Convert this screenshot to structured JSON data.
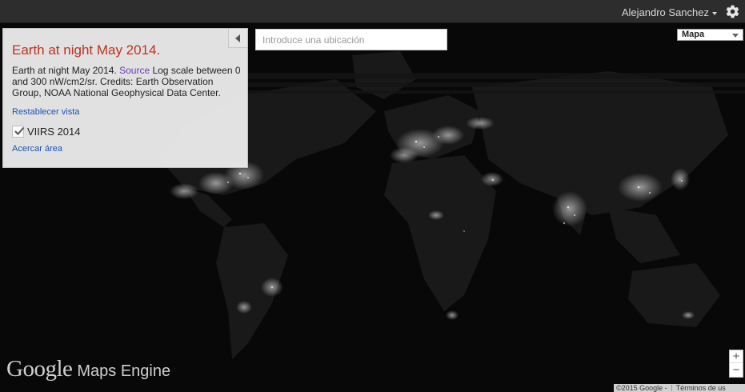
{
  "topbar": {
    "user_name": "Alejandro Sanchez",
    "settings_icon": "gear-icon"
  },
  "panel": {
    "title": "Earth at night May 2014.",
    "desc_before": "Earth at night May 2014. ",
    "desc_link": "Source",
    "desc_after": " Log scale between 0 and 300 nW/cm2/sr. Credits: Earth Observation Group, NOAA National Geophysical Data Center.",
    "reset_label": "Restablecer vista",
    "layer_label": "VIIRS 2014",
    "layer_checked": true,
    "zoom_label": "Acercar área",
    "collapse_icon": "collapse-left-icon"
  },
  "search": {
    "placeholder": "Introduce una ubicación",
    "value": ""
  },
  "map_type": {
    "selected": "Mapa"
  },
  "zoom": {
    "in_label": "+",
    "out_label": "−"
  },
  "logo": {
    "google": "Google",
    "product": "Maps Engine"
  },
  "attribution": {
    "copyright": "©2015 Google -",
    "terms": "Términos de us"
  },
  "colors": {
    "title_red": "#c1301a",
    "link_blue": "#1a54b4",
    "source_link": "#6b3bb5",
    "topbar": "#2d2d2d"
  }
}
